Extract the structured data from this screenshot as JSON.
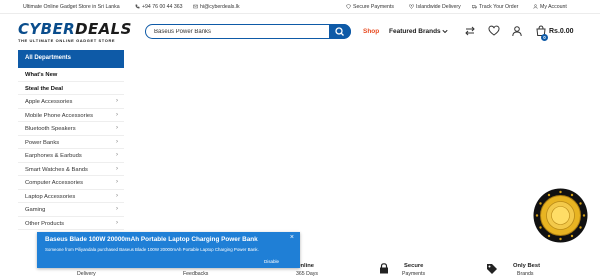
{
  "topbar": {
    "tagline": "Ultimate Online Gadget Store in Sri Lanka",
    "phone": "+94 76 00 44 363",
    "email": "hi@cyberdeals.lk",
    "secure_payments": "Secure Payments",
    "islandwide_delivery": "Islandwide Delivery",
    "track_order": "Track Your Order",
    "my_account": "My Account"
  },
  "logo": {
    "brand_part1": "CYBER",
    "brand_part2": "DEALS",
    "tagline": "THE ULTIMATE ONLINE GADGET STORE"
  },
  "search": {
    "value": "Baseus Power Banks"
  },
  "nav": {
    "shop": "Shop",
    "featured_brands": "Featured Brands"
  },
  "cart": {
    "count": "0",
    "total": "Rs.0.00"
  },
  "sidebar": {
    "header": "All Departments",
    "items": [
      {
        "label": "What's New",
        "bold": true,
        "chevron": false
      },
      {
        "label": "Steal the Deal",
        "bold": true,
        "chevron": false
      },
      {
        "label": "Apple Accessories",
        "bold": false,
        "chevron": true
      },
      {
        "label": "Mobile Phone Accessories",
        "bold": false,
        "chevron": true
      },
      {
        "label": "Bluetooth Speakers",
        "bold": false,
        "chevron": true
      },
      {
        "label": "Power Banks",
        "bold": false,
        "chevron": true
      },
      {
        "label": "Earphones & Earbuds",
        "bold": false,
        "chevron": true
      },
      {
        "label": "Smart Watches & Bands",
        "bold": false,
        "chevron": true
      },
      {
        "label": "Computer Accessories",
        "bold": false,
        "chevron": true
      },
      {
        "label": "Laptop Accessories",
        "bold": false,
        "chevron": true
      },
      {
        "label": "Gaming",
        "bold": false,
        "chevron": true
      },
      {
        "label": "Other Products",
        "bold": false,
        "chevron": true
      }
    ]
  },
  "features": {
    "delivery_sub": "Delivery",
    "feedbacks_sub": "Feedbacks",
    "online_label": "Online",
    "online_sub": "365 Days",
    "secure_label": "Secure",
    "secure_sub": "Payments",
    "brands_label": "Only Best",
    "brands_sub": "Brands"
  },
  "notification": {
    "title": "Baseus Blade 100W 20000mAh Portable Laptop Charging Power Bank",
    "message": "Someone from Piliyandala purchased Baseus Blade 100W 20000mAh Portable Laptop Charging Power Bank.",
    "disable": "Disable",
    "close_glyph": "×"
  },
  "colors": {
    "primary": "#0e5aa7",
    "accent": "#e84a1f",
    "popup": "#1f7fd6"
  }
}
